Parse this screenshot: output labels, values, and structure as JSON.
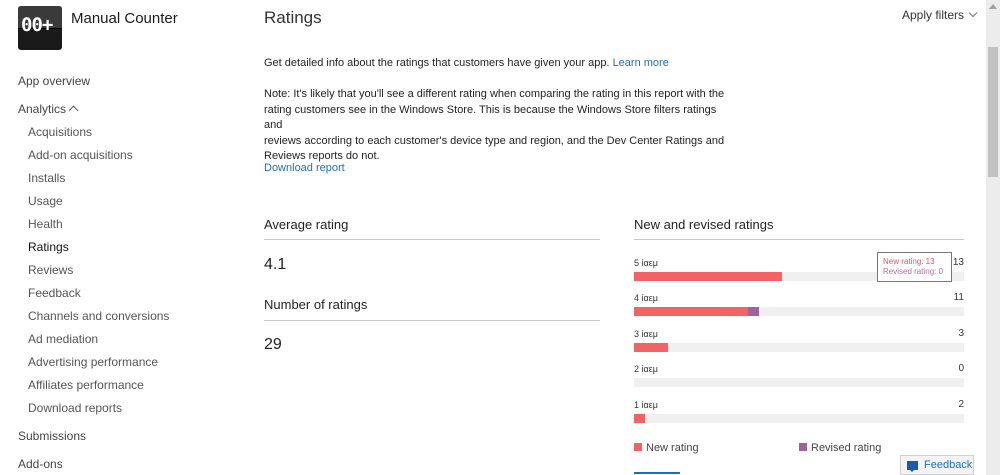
{
  "app": {
    "name": "Manual Counter",
    "logo_text": "00+"
  },
  "sidebar": {
    "app_overview": "App overview",
    "analytics": "Analytics",
    "analytics_items": [
      "Acquisitions",
      "Add-on acquisitions",
      "Installs",
      "Usage",
      "Health",
      "Ratings",
      "Reviews",
      "Feedback",
      "Channels and conversions",
      "Ad mediation",
      "Advertising performance",
      "Affiliates performance",
      "Download reports"
    ],
    "active_item": "Ratings",
    "submissions": "Submissions",
    "addons": "Add-ons"
  },
  "header": {
    "title": "Ratings",
    "apply_filters": "Apply filters"
  },
  "intro": {
    "text": "Get detailed info about the ratings that customers have given your app.",
    "learn_more": "Learn more"
  },
  "note": {
    "line1": "Note: It's likely that you'll see a different rating when comparing the rating in this report with the",
    "line2": "rating customers see in the Windows Store. This is because the Windows Store filters ratings and",
    "line3": "reviews according to each customer's device type and region, and the Dev Center Ratings and",
    "line4": "Reviews reports do not."
  },
  "download_report": "Download report",
  "average": {
    "title": "Average rating",
    "value": "4.1"
  },
  "number": {
    "title": "Number of ratings",
    "value": "29"
  },
  "chart": {
    "title": "New and revised ratings"
  },
  "chart_data": {
    "type": "bar",
    "orientation": "horizontal",
    "stacked": true,
    "categories": [
      "5 ίαεμ",
      "4 ίαεμ",
      "3 ίαεμ",
      "2 ίαεμ",
      "1 ίαεμ"
    ],
    "totals": [
      "13",
      "11",
      "3",
      "0",
      "2"
    ],
    "max": 29,
    "series": [
      {
        "name": "New rating",
        "color": "#f26464",
        "values": [
          13,
          10,
          3,
          0,
          1
        ]
      },
      {
        "name": "Revised rating",
        "color": "#a0629c",
        "values": [
          0,
          1,
          0,
          0,
          0
        ]
      }
    ],
    "tooltip": {
      "new": "New rating: 13",
      "revised": "Revised rating: 0"
    }
  },
  "legend": {
    "new": "New rating",
    "revised": "Revised rating"
  },
  "feedback": "Feedback",
  "colors": {
    "link": "#1a6fc4",
    "new": "#f26464",
    "revised": "#a0629c"
  }
}
